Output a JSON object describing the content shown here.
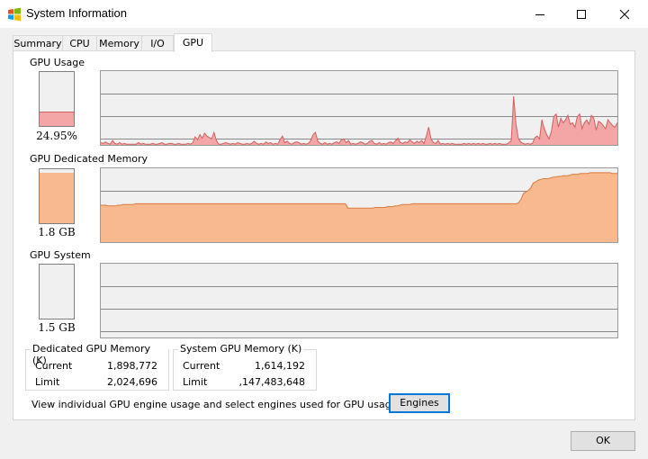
{
  "window": {
    "title": "System Information"
  },
  "tabs": [
    {
      "label": "Summary"
    },
    {
      "label": "CPU"
    },
    {
      "label": "Memory"
    },
    {
      "label": "I/O"
    },
    {
      "label": "GPU"
    }
  ],
  "active_tab": "GPU",
  "colors": {
    "usage": "#f4a6a6",
    "usage_line": "#d06060",
    "memory": "#f9b98e",
    "memory_line": "#d97a3e",
    "grid": "#888888",
    "graph_bg": "#f0f0f0"
  },
  "gpu_usage": {
    "label": "GPU Usage",
    "value": "24.95%",
    "level_fraction": 0.2495,
    "history": [
      3,
      2,
      4,
      2,
      1,
      6,
      2,
      1,
      3,
      1,
      2,
      1,
      1,
      1,
      1,
      1,
      3,
      1,
      2,
      1,
      1,
      1,
      2,
      1,
      1,
      2,
      3,
      1,
      1,
      2,
      2,
      1,
      1,
      2,
      1,
      1,
      1,
      2,
      1,
      3,
      11,
      7,
      14,
      9,
      16,
      12,
      10,
      8,
      17,
      6,
      1,
      1,
      2,
      3,
      2,
      1,
      2,
      1,
      3,
      2,
      1,
      1,
      2,
      1,
      2,
      5,
      2,
      1,
      2,
      1,
      4,
      2,
      3,
      1,
      2,
      1,
      7,
      12,
      3,
      5,
      2,
      1,
      3,
      4,
      3,
      1,
      2,
      1,
      2,
      6,
      14,
      17,
      5,
      2,
      1,
      3,
      1,
      2,
      1,
      3,
      4,
      2,
      7,
      8,
      3,
      6,
      1,
      2,
      1,
      2,
      4,
      3,
      1,
      2,
      5,
      6,
      2,
      1,
      3,
      1,
      2,
      1,
      3,
      4,
      2,
      6,
      9,
      3,
      2,
      4,
      3,
      7,
      4,
      2,
      5,
      3,
      6,
      2,
      12,
      24,
      8,
      3,
      2,
      6,
      1,
      2,
      1,
      2,
      1,
      2,
      1,
      1,
      1,
      1,
      2,
      1,
      2,
      1,
      2,
      1,
      2,
      1,
      2,
      1,
      1,
      2,
      1,
      2,
      1,
      2,
      1,
      1,
      1,
      3,
      6,
      66,
      28,
      9,
      4,
      2,
      1,
      2,
      1,
      2,
      10,
      12,
      8,
      34,
      22,
      14,
      8,
      18,
      38,
      42,
      24,
      36,
      30,
      34,
      40,
      28,
      30,
      24,
      38,
      42,
      22,
      30,
      34,
      28,
      40,
      36,
      20,
      32,
      30,
      26,
      22,
      34,
      30,
      26,
      24,
      30
    ]
  },
  "gpu_memory": {
    "label": "GPU Dedicated Memory",
    "value": "1.8 GB",
    "level_fraction": 0.93,
    "history": [
      50,
      50,
      50,
      49,
      49,
      49,
      49,
      50,
      50,
      51,
      51,
      51,
      51,
      51,
      52,
      52,
      52,
      52,
      52,
      52,
      52,
      52,
      52,
      52,
      52,
      52,
      52,
      52,
      52,
      52,
      52,
      52,
      52,
      52,
      52,
      52,
      52,
      52,
      52,
      52,
      52,
      52,
      52,
      52,
      52,
      52,
      52,
      52,
      52,
      52,
      52,
      52,
      52,
      52,
      52,
      52,
      52,
      52,
      52,
      52,
      52,
      52,
      52,
      52,
      52,
      52,
      52,
      52,
      52,
      52,
      52,
      52,
      52,
      52,
      52,
      52,
      52,
      52,
      52,
      52,
      52,
      52,
      52,
      52,
      52,
      52,
      52,
      52,
      52,
      52,
      52,
      52,
      52,
      52,
      52,
      52,
      52,
      52,
      52,
      52,
      46,
      46,
      46,
      46,
      46,
      46,
      46,
      46,
      46,
      46,
      46,
      47,
      47,
      47,
      47,
      47,
      48,
      48,
      48,
      49,
      49,
      50,
      51,
      51,
      51,
      51,
      52,
      52,
      52,
      52,
      52,
      52,
      52,
      52,
      52,
      52,
      52,
      52,
      52,
      52,
      52,
      52,
      52,
      52,
      52,
      52,
      52,
      52,
      52,
      52,
      52,
      52,
      52,
      52,
      52,
      52,
      52,
      52,
      52,
      52,
      52,
      52,
      52,
      52,
      52,
      52,
      52,
      52,
      52,
      53,
      58,
      66,
      68,
      70,
      74,
      80,
      82,
      84,
      85,
      86,
      86,
      86,
      87,
      88,
      88,
      89,
      89,
      90,
      90,
      90,
      91,
      92,
      92,
      92,
      93,
      93,
      93,
      93,
      94,
      94,
      94,
      94,
      94,
      94,
      94,
      94,
      94,
      93,
      93,
      93
    ]
  },
  "gpu_system": {
    "label": "GPU System",
    "value": "1.5 GB",
    "level_fraction": 0.0
  },
  "dedicated_memory": {
    "title": "Dedicated GPU Memory (K)",
    "current_label": "Current",
    "current_value": "1,898,772",
    "limit_label": "Limit",
    "limit_value": "2,024,696"
  },
  "system_memory": {
    "title": "System GPU Memory (K)",
    "current_label": "Current",
    "current_value": "1,614,192",
    "limit_label": "Limit",
    "limit_value": ",147,483,648"
  },
  "footer": {
    "hint": "View individual GPU engine usage and select engines used for GPU usage",
    "engines_button": "Engines",
    "ok_button": "OK"
  }
}
